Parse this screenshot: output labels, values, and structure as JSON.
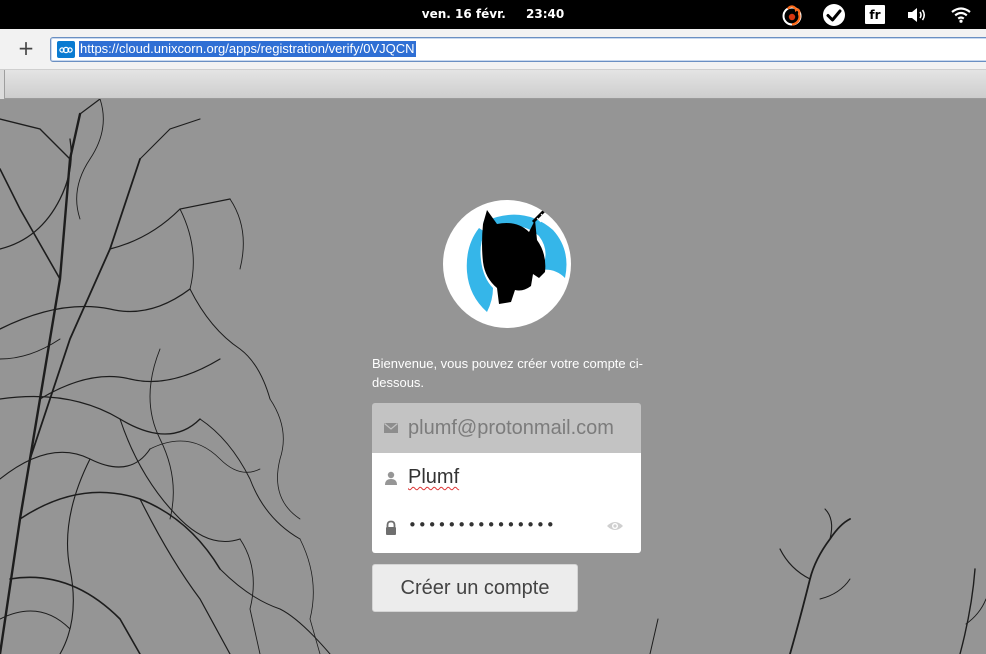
{
  "panel": {
    "date": "ven. 16 févr.",
    "time": "23:40",
    "keyboard_layout": "fr",
    "tray_icons": [
      "firefox-flame-icon",
      "checkmark-icon",
      "keyboard-layout-badge",
      "volume-icon",
      "wifi-icon"
    ]
  },
  "browser": {
    "new_tab_label": "+",
    "url": "https://cloud.unixcorn.org/apps/registration/verify/0VJQCN",
    "favicon": "nextcloud-icon"
  },
  "page": {
    "welcome_text": "Bienvenue, vous pouvez créer votre compte ci-dessous.",
    "email_placeholder": "plumf@protonmail.com",
    "username_value": "Plumf",
    "password_mask": "•••••••••••••••",
    "submit_label": "Créer un compte",
    "logo": "unicorn-logo",
    "colors": {
      "background": "#959595",
      "logo_blue": "#35b6e9",
      "url_highlight": "#2f6fd4"
    }
  }
}
